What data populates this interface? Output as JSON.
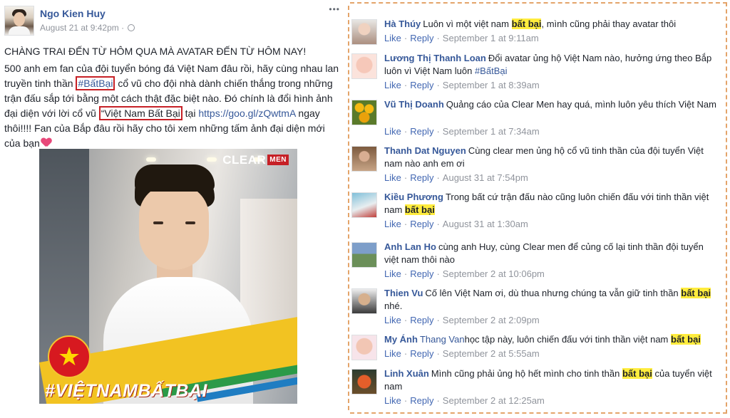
{
  "post": {
    "author": "Ngo Kien Huy",
    "date": "August 21 at 9:42pm",
    "headline": "CHÀNG TRAI ĐẾN TỪ HÔM QUA MÀ AVATAR ĐẾN TỪ HÔM NAY!",
    "body_part1": "500 anh em fan của đội tuyển bóng đá Việt Nam đâu rồi, hãy cùng nhau lan truyền tinh thần ",
    "hashtag": "#BấtBại",
    "body_part2": " cổ vũ cho đội nhà dành chiến thắng trong những trận đấu sắp tới bằng một cách thật đặc biệt nào. Đó chính là đổi hình ảnh đại diện với lời cổ vũ ",
    "slogan": "“Việt Nam Bất Bại",
    "body_part3": " tại ",
    "link": "https://goo.gl/zQwtmA",
    "body_part4": " ngay thôi!!!! Fan của Bắp đâu rồi hãy cho tôi xem những tấm ảnh đại diện mới của bạn",
    "image": {
      "brand": "CLEAR",
      "brand_sub": "MEN",
      "hashtag_overlay": "#VIỆTNAMBẤTBẠI"
    }
  },
  "comment_actions": {
    "like": "Like",
    "reply": "Reply"
  },
  "comments": [
    {
      "name": "Hà Thúy",
      "pre": "Luôn vì một việt nam ",
      "hl": "bất bại",
      "post": ", mình cũng phải thay avatar thôi",
      "time": "September 1 at 9:11am"
    },
    {
      "name": "Lương Thị Thanh Loan",
      "pre": "Đổi avatar ủng hộ Việt Nam nào, hưởng ứng theo Bắp luôn vì Việt Nam luôn ",
      "tag": "#BấtBại",
      "time": "September 1 at 8:39am"
    },
    {
      "name": "Vũ Thị Doanh",
      "pre": "Quảng cáo của Clear Men hay quá, mình luôn yêu thích Việt Nam",
      "time": "September 1 at 7:34am"
    },
    {
      "name": "Thanh Dat Nguyen",
      "pre": "Cùng clear men ủng hộ cổ vũ tinh thần của đội tuyển Việt nam nào anh em ơi",
      "time": "August 31 at 7:54pm"
    },
    {
      "name": "Kiều Phương",
      "pre": "Trong bất cứ trận đấu nào cũng luôn chiến đấu với tinh thần việt nam ",
      "hl": "bất bại",
      "time": "August 31 at 1:30am"
    },
    {
      "name": "Anh Lan Ho",
      "pre": "cùng anh Huy, cùng Clear men để củng cố lại tinh thần đội tuyển việt nam thôi nào",
      "time": "September 2 at 10:06pm"
    },
    {
      "name": "Thien Vu",
      "pre": "Cố lên Việt Nam ơi, dù thua nhưng chúng ta vẫn giữ tinh thần ",
      "hl": "bất bại",
      "post": " nhé.",
      "time": "September 2 at 2:09pm"
    },
    {
      "name": "My Ánh",
      "name2": "Thang Van",
      "pre": "học tập này, luôn chiến đấu với tinh thần việt nam ",
      "hl": "bất bại",
      "time": "September 2 at 5:55am"
    },
    {
      "name": "Linh Xuân",
      "pre": "Mình cũng phải ủng hộ hết mình cho tinh thần ",
      "hl": "bất bại",
      "post": " của tuyển việt nam",
      "time": "September 2 at 12:25am"
    }
  ],
  "colors": {
    "link": "#365899",
    "highlight": "#ffec3d",
    "box_red": "#c62026",
    "dashed_border": "#e4a46a"
  }
}
